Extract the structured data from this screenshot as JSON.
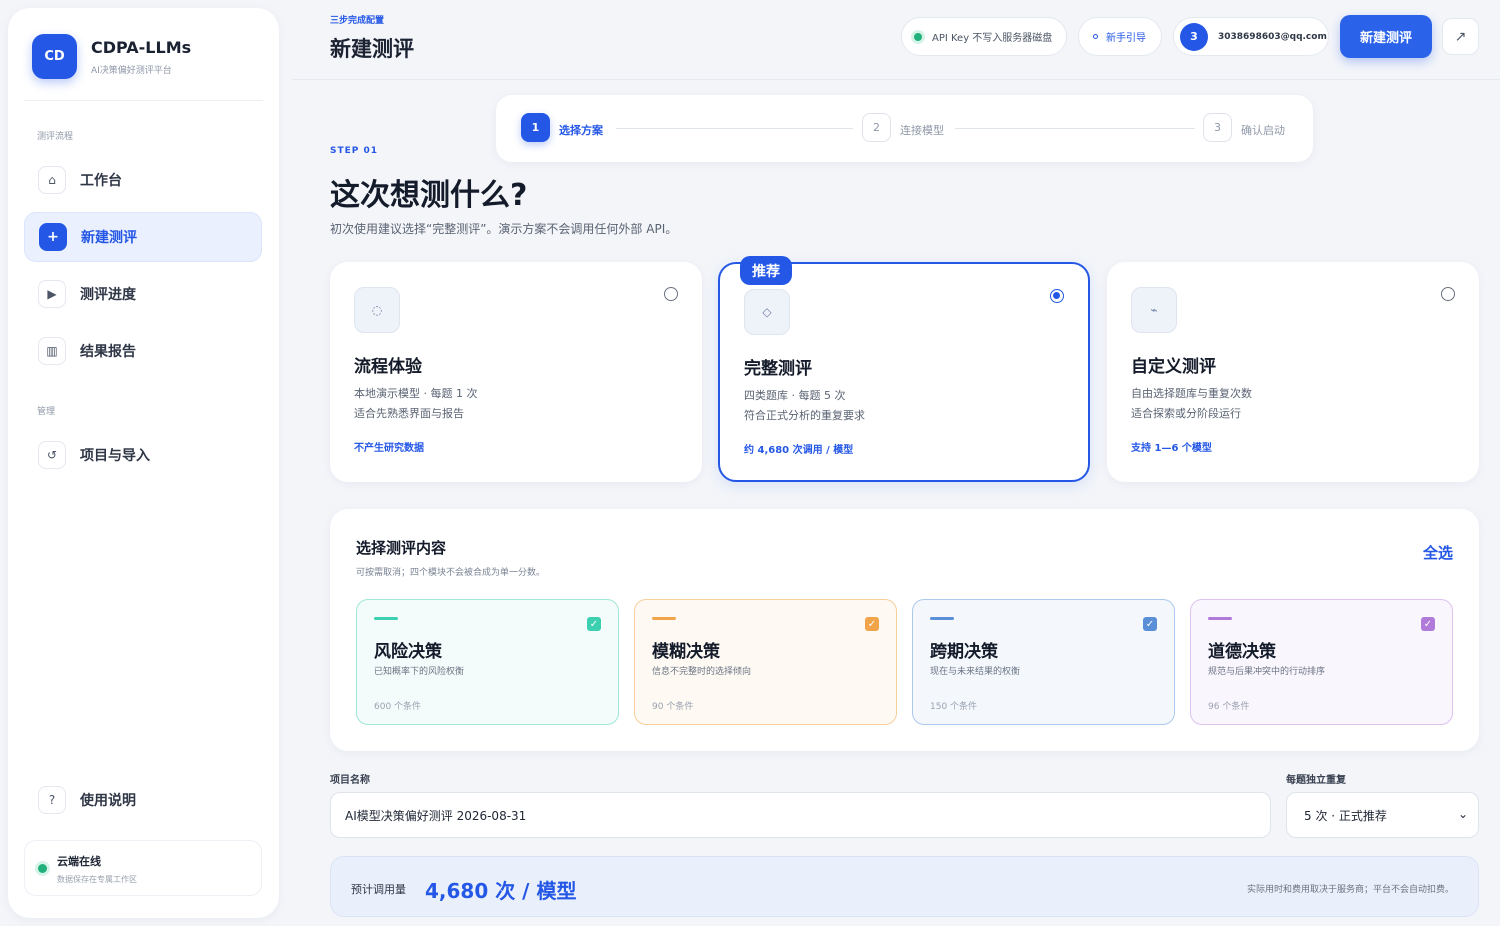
{
  "brand": {
    "logo": "CD",
    "title": "CDPA-LLMs",
    "subtitle": "AI决策偏好测评平台"
  },
  "sidebar": {
    "section_flow": "测评流程",
    "section_manage": "管理",
    "items": [
      {
        "icon": "home-icon",
        "glyph": "⌂",
        "label": "工作台"
      },
      {
        "icon": "plus-icon",
        "glyph": "+",
        "label": "新建测评"
      },
      {
        "icon": "play-icon",
        "glyph": "▶",
        "label": "测评进度"
      },
      {
        "icon": "report-icon",
        "glyph": "▥",
        "label": "结果报告"
      },
      {
        "icon": "import-icon",
        "glyph": "↺",
        "label": "项目与导入"
      },
      {
        "icon": "help-icon",
        "glyph": "?",
        "label": "使用说明"
      }
    ],
    "active_item": "新建测评",
    "cloud": {
      "title": "云端在线",
      "subtitle": "数据保存在专属工作区",
      "status_color": "#22b07d"
    }
  },
  "header": {
    "subtitle": "三步完成配置",
    "title": "新建测评",
    "api_status": "API Key 不写入服务器磁盘",
    "guide": "新手引导",
    "user_badge": "3",
    "user_email": "3038698603@qq.com",
    "new_button": "新建测评",
    "external_icon": "↗"
  },
  "stepper": {
    "steps": [
      {
        "num": "1",
        "label": "选择方案"
      },
      {
        "num": "2",
        "label": "连接模型"
      },
      {
        "num": "3",
        "label": "确认启动"
      }
    ],
    "current": 1
  },
  "intro": {
    "kicker": "STEP 01",
    "title": "这次想测什么?",
    "desc": "初次使用建议选择“完整测评”。演示方案不会调用任何外部 API。"
  },
  "plans": [
    {
      "icon_glyph": "◌",
      "name": "流程体验",
      "line1": "本地演示模型 · 每题 1 次",
      "line2": "适合先熟悉界面与报告",
      "note": "不产生研究数据",
      "selected": false
    },
    {
      "icon_glyph": "◇",
      "name": "完整测评",
      "line1": "四类题库 · 每题 5 次",
      "line2": "符合正式分析的重复要求",
      "note": "约 4,680 次调用 / 模型",
      "selected": true,
      "tag": "推荐"
    },
    {
      "icon_glyph": "⌁",
      "name": "自定义测评",
      "line1": "自由选择题库与重复次数",
      "line2": "适合探索或分阶段运行",
      "note": "支持 1—6 个模型",
      "selected": false
    }
  ],
  "modules": {
    "title": "选择测评内容",
    "desc": "可按需取消；四个模块不会被合成为单一分数。",
    "select_all": "全选",
    "items": [
      {
        "name": "风险决策",
        "desc": "已知概率下的风险权衡",
        "count": "600 个条件",
        "checked": true,
        "accent": "#3ccfb0",
        "border": "#9fe6d6",
        "bg": "#f3fcfa"
      },
      {
        "name": "模糊决策",
        "desc": "信息不完整时的选择倾向",
        "count": "90 个条件",
        "checked": true,
        "accent": "#f2a44a",
        "border": "#f6cf9c",
        "bg": "#fefaf3"
      },
      {
        "name": "跨期决策",
        "desc": "现在与未来结果的权衡",
        "count": "150 个条件",
        "checked": true,
        "accent": "#5a8fd8",
        "border": "#acc8ec",
        "bg": "#f4f8fd"
      },
      {
        "name": "道德决策",
        "desc": "规范与后果冲突中的行动排序",
        "count": "96 个条件",
        "checked": true,
        "accent": "#b07ad8",
        "border": "#dcc2ef",
        "bg": "#faf6fd"
      }
    ]
  },
  "form": {
    "name_label": "项目名称",
    "name_value": "AI模型决策偏好测评 2026-08-31",
    "repeat_label": "每题独立重复",
    "repeat_value": "5 次 · 正式推荐"
  },
  "estimate": {
    "label": "预计调用量",
    "value": "4,680 次 / 模型",
    "note": "实际用时和费用取决于服务商；平台不会自动扣费。"
  },
  "colors": {
    "accent": "#2457e6",
    "background": "#f3f5f9",
    "success": "#22b07d"
  }
}
